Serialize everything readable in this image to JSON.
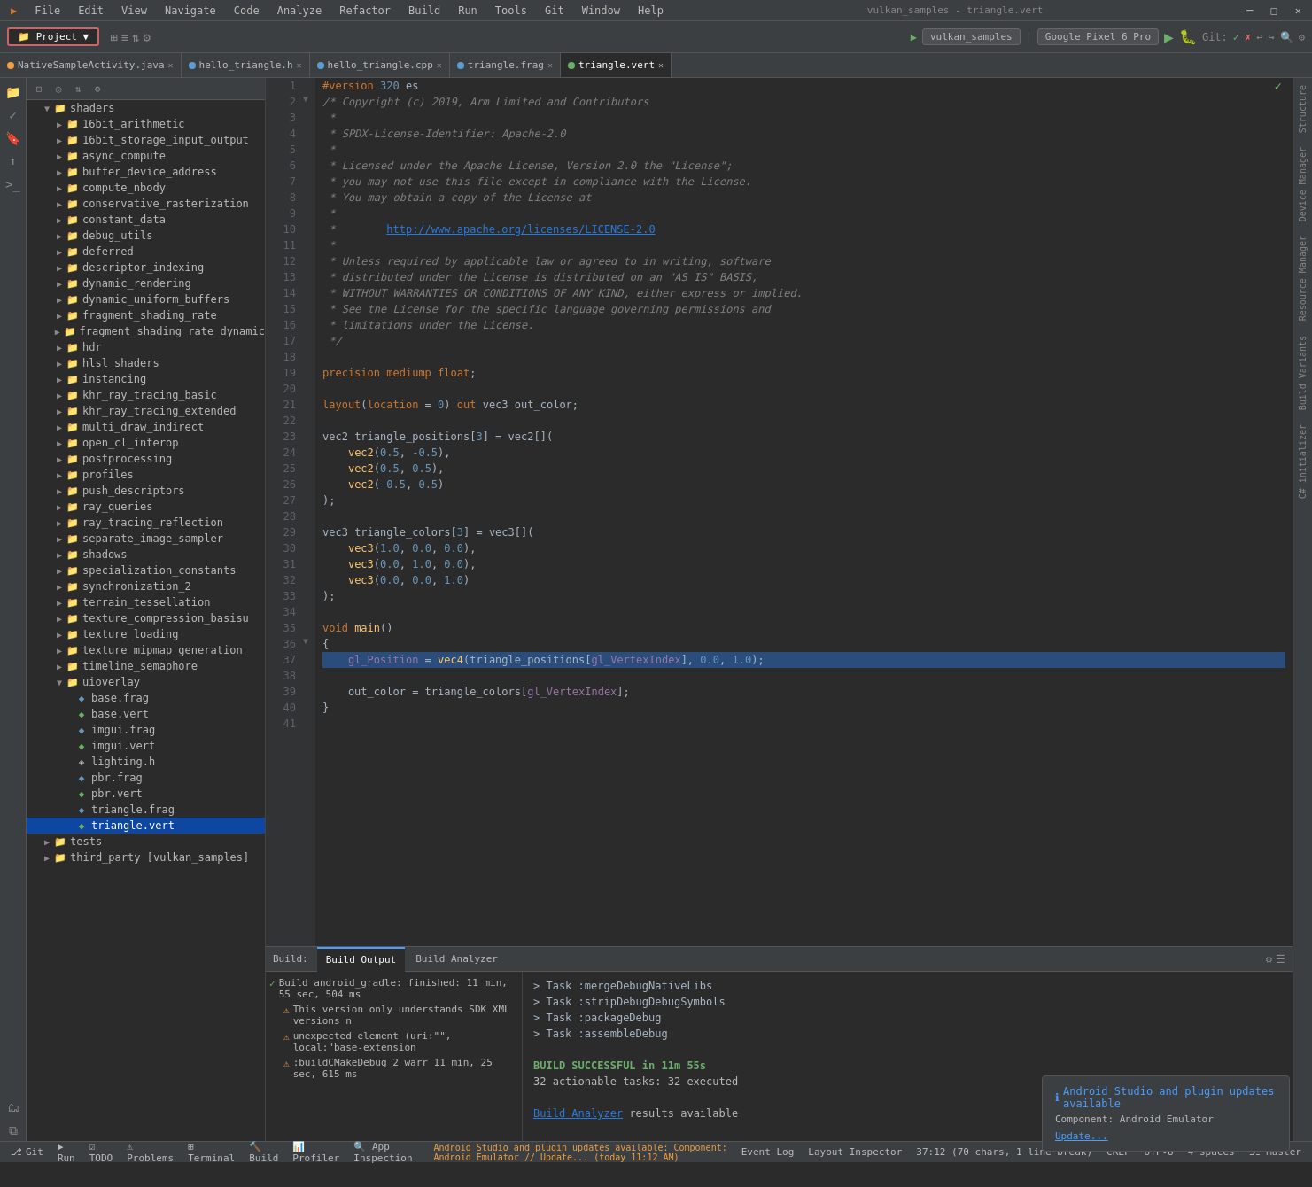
{
  "app": {
    "title": "vulkan_samples - triangle.vert",
    "menu_items": [
      "File",
      "Edit",
      "View",
      "Navigate",
      "Code",
      "Analyze",
      "Refactor",
      "Build",
      "Run",
      "Tools",
      "Git",
      "Window",
      "Help"
    ]
  },
  "toolbar": {
    "project_tab": "Project",
    "tabs": [
      "NativeSampleActivity.java",
      "hello_triangle.h",
      "hello_triangle.cpp",
      "triangle.frag",
      "triangle.vert"
    ],
    "active_tab": "triangle.vert",
    "device": "vulkan_samples",
    "phone": "Google Pixel 6 Pro"
  },
  "project_tree": {
    "header": "Project",
    "items": [
      {
        "label": "shaders",
        "type": "folder",
        "level": 2,
        "expanded": true
      },
      {
        "label": "16bit_arithmetic",
        "type": "folder",
        "level": 3
      },
      {
        "label": "16bit_storage_input_output",
        "type": "folder",
        "level": 3
      },
      {
        "label": "async_compute",
        "type": "folder",
        "level": 3
      },
      {
        "label": "buffer_device_address",
        "type": "folder",
        "level": 3
      },
      {
        "label": "compute_nbody",
        "type": "folder",
        "level": 3
      },
      {
        "label": "conservative_rasterization",
        "type": "folder",
        "level": 3
      },
      {
        "label": "constant_data",
        "type": "folder",
        "level": 3
      },
      {
        "label": "debug_utils",
        "type": "folder",
        "level": 3
      },
      {
        "label": "deferred",
        "type": "folder",
        "level": 3
      },
      {
        "label": "descriptor_indexing",
        "type": "folder",
        "level": 3
      },
      {
        "label": "dynamic_rendering",
        "type": "folder",
        "level": 3
      },
      {
        "label": "dynamic_uniform_buffers",
        "type": "folder",
        "level": 3
      },
      {
        "label": "fragment_shading_rate",
        "type": "folder",
        "level": 3
      },
      {
        "label": "fragment_shading_rate_dynamic",
        "type": "folder",
        "level": 3
      },
      {
        "label": "hdr",
        "type": "folder",
        "level": 3
      },
      {
        "label": "hlsl_shaders",
        "type": "folder",
        "level": 3
      },
      {
        "label": "instancing",
        "type": "folder",
        "level": 3
      },
      {
        "label": "khr_ray_tracing_basic",
        "type": "folder",
        "level": 3
      },
      {
        "label": "khr_ray_tracing_extended",
        "type": "folder",
        "level": 3
      },
      {
        "label": "multi_draw_indirect",
        "type": "folder",
        "level": 3
      },
      {
        "label": "open_cl_interop",
        "type": "folder",
        "level": 3
      },
      {
        "label": "postprocessing",
        "type": "folder",
        "level": 3
      },
      {
        "label": "profiles",
        "type": "folder",
        "level": 3
      },
      {
        "label": "push_descriptors",
        "type": "folder",
        "level": 3
      },
      {
        "label": "ray_queries",
        "type": "folder",
        "level": 3
      },
      {
        "label": "ray_tracing_reflection",
        "type": "folder",
        "level": 3
      },
      {
        "label": "separate_image_sampler",
        "type": "folder",
        "level": 3
      },
      {
        "label": "shadows",
        "type": "folder",
        "level": 3
      },
      {
        "label": "specialization_constants",
        "type": "folder",
        "level": 3
      },
      {
        "label": "synchronization_2",
        "type": "folder",
        "level": 3
      },
      {
        "label": "terrain_tessellation",
        "type": "folder",
        "level": 3
      },
      {
        "label": "texture_compression_basisu",
        "type": "folder",
        "level": 3
      },
      {
        "label": "texture_loading",
        "type": "folder",
        "level": 3
      },
      {
        "label": "texture_mipmap_generation",
        "type": "folder",
        "level": 3
      },
      {
        "label": "timeline_semaphore",
        "type": "folder",
        "level": 3
      },
      {
        "label": "uioverlay",
        "type": "folder",
        "level": 3,
        "expanded": true
      },
      {
        "label": "base.frag",
        "type": "frag",
        "level": 4
      },
      {
        "label": "base.vert",
        "type": "vert",
        "level": 4
      },
      {
        "label": "imgui.frag",
        "type": "frag",
        "level": 4
      },
      {
        "label": "imgui.vert",
        "type": "vert",
        "level": 4
      },
      {
        "label": "lighting.h",
        "type": "h",
        "level": 4
      },
      {
        "label": "pbr.frag",
        "type": "frag",
        "level": 4
      },
      {
        "label": "pbr.vert",
        "type": "vert",
        "level": 4
      },
      {
        "label": "triangle.frag",
        "type": "frag",
        "level": 4
      },
      {
        "label": "triangle.vert",
        "type": "vert",
        "level": 4,
        "selected": true
      },
      {
        "label": "tests",
        "type": "folder",
        "level": 2
      },
      {
        "label": "third_party [vulkan_samples]",
        "type": "folder",
        "level": 2
      }
    ]
  },
  "editor": {
    "filename": "triangle.vert",
    "lines": [
      {
        "num": 1,
        "content": "#version 320 es"
      },
      {
        "num": 2,
        "content": "/* Copyright (c) 2019, Arm Limited and Contributors"
      },
      {
        "num": 3,
        "content": " *"
      },
      {
        "num": 4,
        "content": " * SPDX-License-Identifier: Apache-2.0"
      },
      {
        "num": 5,
        "content": " *"
      },
      {
        "num": 6,
        "content": " * Licensed under the Apache License, Version 2.0 the \"License\";"
      },
      {
        "num": 7,
        "content": " * you may not use this file except in compliance with the License."
      },
      {
        "num": 8,
        "content": " * You may obtain a copy of the License at"
      },
      {
        "num": 9,
        "content": " *"
      },
      {
        "num": 10,
        "content": " *        http://www.apache.org/licenses/LICENSE-2.0"
      },
      {
        "num": 11,
        "content": " *"
      },
      {
        "num": 12,
        "content": " * Unless required by applicable law or agreed to in writing, software"
      },
      {
        "num": 13,
        "content": " * distributed under the License is distributed on an \"AS IS\" BASIS,"
      },
      {
        "num": 14,
        "content": " * WITHOUT WARRANTIES OR CONDITIONS OF ANY KIND, either express or implied."
      },
      {
        "num": 15,
        "content": " * See the License for the specific language governing permissions and"
      },
      {
        "num": 16,
        "content": " * limitations under the License."
      },
      {
        "num": 17,
        "content": " */"
      },
      {
        "num": 18,
        "content": ""
      },
      {
        "num": 19,
        "content": "precision mediump float;"
      },
      {
        "num": 20,
        "content": ""
      },
      {
        "num": 21,
        "content": "layout(location = 0) out vec3 out_color;"
      },
      {
        "num": 22,
        "content": ""
      },
      {
        "num": 23,
        "content": "vec2 triangle_positions[3] = vec2[]("
      },
      {
        "num": 24,
        "content": "    vec2(0.5, -0.5),"
      },
      {
        "num": 25,
        "content": "    vec2(0.5, 0.5),"
      },
      {
        "num": 26,
        "content": "    vec2(-0.5, 0.5)"
      },
      {
        "num": 27,
        "content": ");"
      },
      {
        "num": 28,
        "content": ""
      },
      {
        "num": 29,
        "content": "vec3 triangle_colors[3] = vec3[]("
      },
      {
        "num": 30,
        "content": "    vec3(1.0, 0.0, 0.0),"
      },
      {
        "num": 31,
        "content": "    vec3(0.0, 1.0, 0.0),"
      },
      {
        "num": 32,
        "content": "    vec3(0.0, 0.0, 1.0)"
      },
      {
        "num": 33,
        "content": ");"
      },
      {
        "num": 34,
        "content": ""
      },
      {
        "num": 35,
        "content": "void main()"
      },
      {
        "num": 36,
        "content": "{"
      },
      {
        "num": 37,
        "content": "    gl_Position = vec4(triangle_positions[gl_VertexIndex], 0.0, 1.0);",
        "highlighted": true
      },
      {
        "num": 38,
        "content": ""
      },
      {
        "num": 39,
        "content": "    out_color = triangle_colors[gl_VertexIndex];"
      },
      {
        "num": 40,
        "content": "}"
      },
      {
        "num": 41,
        "content": ""
      }
    ]
  },
  "bottom_panel": {
    "build_tab": "Build Output",
    "analyzer_tab": "Build Analyzer",
    "build_items": [
      {
        "type": "success",
        "label": "Build android_gradle: finished: 11 min, 55 sec, 504 ms"
      },
      {
        "type": "warn",
        "label": "This version only understands SDK XML versions n"
      },
      {
        "type": "warn",
        "label": "unexpected element (uri:\"\", local:\"base-extension"
      },
      {
        "type": "warn",
        "label": ":buildCMakeDebug 2 warr 11 min, 25 sec, 615 ms"
      }
    ],
    "log_lines": [
      "> Task :mergeDebugNativeLibs",
      "> Task :stripDebugDebugSymbols",
      "> Task :packageDebug",
      "> Task :assembleDebug",
      "",
      "BUILD SUCCESSFUL in 11m 55s",
      "32 actionable tasks: 32 executed",
      "",
      "Build Analyzer results available"
    ]
  },
  "status_bar": {
    "git": "Git",
    "run": "Run",
    "todo": "TODO",
    "problems": "Problems",
    "terminal": "Terminal",
    "build": "Build",
    "profiler": "Profiler",
    "app_inspection": "App Inspection",
    "event_log": "Event Log",
    "layout_inspector": "Layout Inspector",
    "position": "37:12 (70 chars, 1 line break)",
    "encoding": "CRLF",
    "charset": "UTF-8",
    "indent": "4 spaces",
    "branch": "master",
    "warning_text": "Android Studio and plugin updates available: Component: Android Emulator // Update... (today 11:12 AM)"
  },
  "notification": {
    "title": "Android Studio and plugin updates available",
    "body": "Component: Android Emulator",
    "link": "Update..."
  },
  "right_sidebar": {
    "tabs": [
      "Structure",
      "Device Manager",
      "Resource Manager",
      "Build Variants",
      "C# initializer"
    ]
  }
}
